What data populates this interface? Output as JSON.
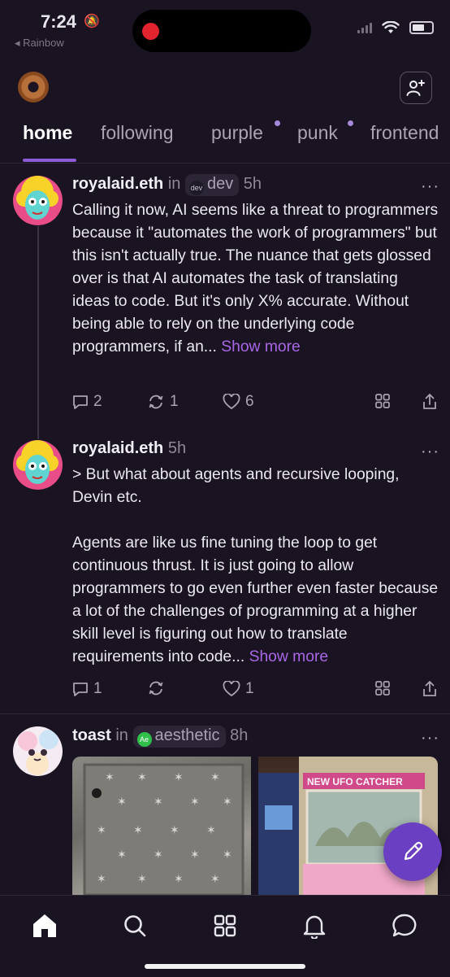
{
  "status_bar": {
    "time": "7:24",
    "back_app": "◂ Rainbow"
  },
  "tabs": [
    {
      "label": "home",
      "active": true
    },
    {
      "label": "following",
      "active": false
    },
    {
      "label": "purple",
      "active": false,
      "unread_dot": true
    },
    {
      "label": "punk",
      "active": false,
      "unread_dot": true
    },
    {
      "label": "frontend",
      "active": false
    }
  ],
  "posts": [
    {
      "author": "royalaid.eth",
      "in_label": "in",
      "channel": "dev",
      "time": "5h",
      "text": "Calling it now, AI seems like a threat to programmers because it \"automates the work of programmers\" but this isn't actually true. The nuance that gets glossed over is that AI automates the task of translating ideas to code. But it's only X% accurate. Without being able to rely on the underlying code programmers, if an...",
      "show_more": "Show more",
      "replies": "2",
      "recasts": "1",
      "likes": "6"
    },
    {
      "author": "royalaid.eth",
      "time": "5h",
      "text": "> But what about agents and recursive looping, Devin etc.\n\nAgents are like us fine tuning the loop to get continuous thrust. It is just going to allow programmers to go even further even faster because a lot of the challenges of programming at a higher skill level is figuring out how to translate requirements into code...",
      "show_more": "Show more",
      "replies": "1",
      "recasts": "",
      "likes": "1"
    },
    {
      "author": "toast",
      "in_label": "in",
      "channel": "aesthetic",
      "channel_icon_text": "Ae",
      "time": "8h",
      "image_caption": "NEW UFO CATCHER"
    }
  ],
  "more_label": "···",
  "colors": {
    "accent": "#8b5cd6",
    "link": "#a867e6",
    "fab": "#6b3fc1",
    "background": "#1a1322"
  }
}
